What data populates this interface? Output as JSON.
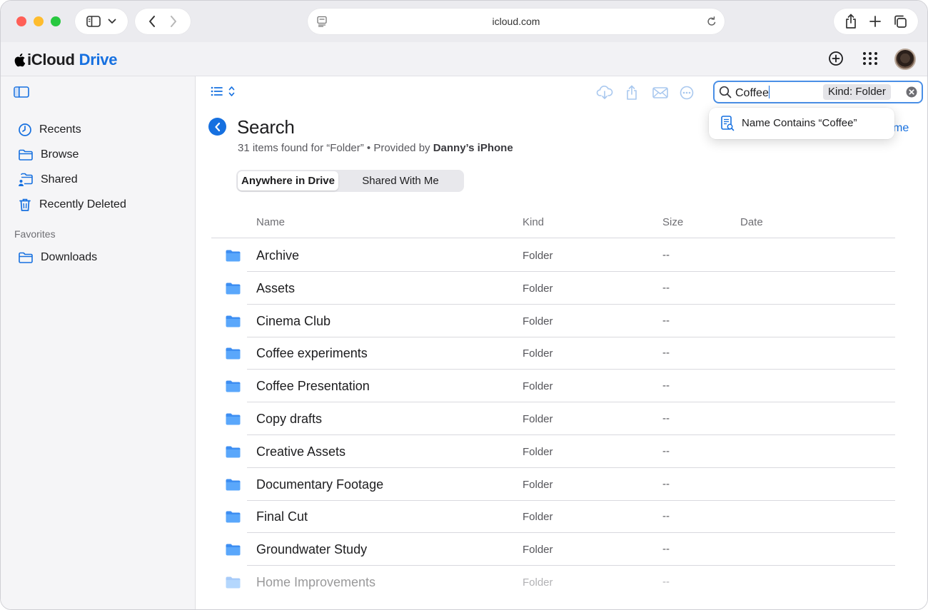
{
  "browser": {
    "address": "icloud.com"
  },
  "app": {
    "title_prefix": "iCloud",
    "title_accent": "Drive",
    "accent_color": "#1670e0"
  },
  "sidebar": {
    "items": [
      {
        "label": "Recents",
        "icon": "clock-icon"
      },
      {
        "label": "Browse",
        "icon": "folder-icon"
      },
      {
        "label": "Shared",
        "icon": "shared-folder-icon"
      },
      {
        "label": "Recently Deleted",
        "icon": "trash-icon"
      }
    ],
    "favorites_heading": "Favorites",
    "favorites": [
      {
        "label": "Downloads",
        "icon": "folder-icon"
      }
    ]
  },
  "search": {
    "query": "Coffee",
    "kind_token": "Kind: Folder",
    "suggestion": "Name Contains “Coffee”"
  },
  "page": {
    "title": "Search",
    "subtitle_prefix": "31 items found for “Folder” • Provided by",
    "subtitle_device": "Danny’s iPhone",
    "partial_link": "me"
  },
  "scope_tabs": [
    {
      "label": "Anywhere in Drive",
      "selected": true
    },
    {
      "label": "Shared With Me",
      "selected": false
    }
  ],
  "table": {
    "columns": {
      "name": "Name",
      "kind": "Kind",
      "size": "Size",
      "date": "Date"
    },
    "rows": [
      {
        "name": "Archive",
        "kind": "Folder",
        "size": "--"
      },
      {
        "name": "Assets",
        "kind": "Folder",
        "size": "--"
      },
      {
        "name": "Cinema Club",
        "kind": "Folder",
        "size": "--"
      },
      {
        "name": "Coffee experiments",
        "kind": "Folder",
        "size": "--"
      },
      {
        "name": "Coffee Presentation",
        "kind": "Folder",
        "size": "--"
      },
      {
        "name": "Copy drafts",
        "kind": "Folder",
        "size": "--"
      },
      {
        "name": "Creative Assets",
        "kind": "Folder",
        "size": "--"
      },
      {
        "name": "Documentary Footage",
        "kind": "Folder",
        "size": "--"
      },
      {
        "name": "Final Cut",
        "kind": "Folder",
        "size": "--"
      },
      {
        "name": "Groundwater Study",
        "kind": "Folder",
        "size": "--"
      },
      {
        "name": "Home Improvements",
        "kind": "Folder",
        "size": "--"
      }
    ]
  }
}
